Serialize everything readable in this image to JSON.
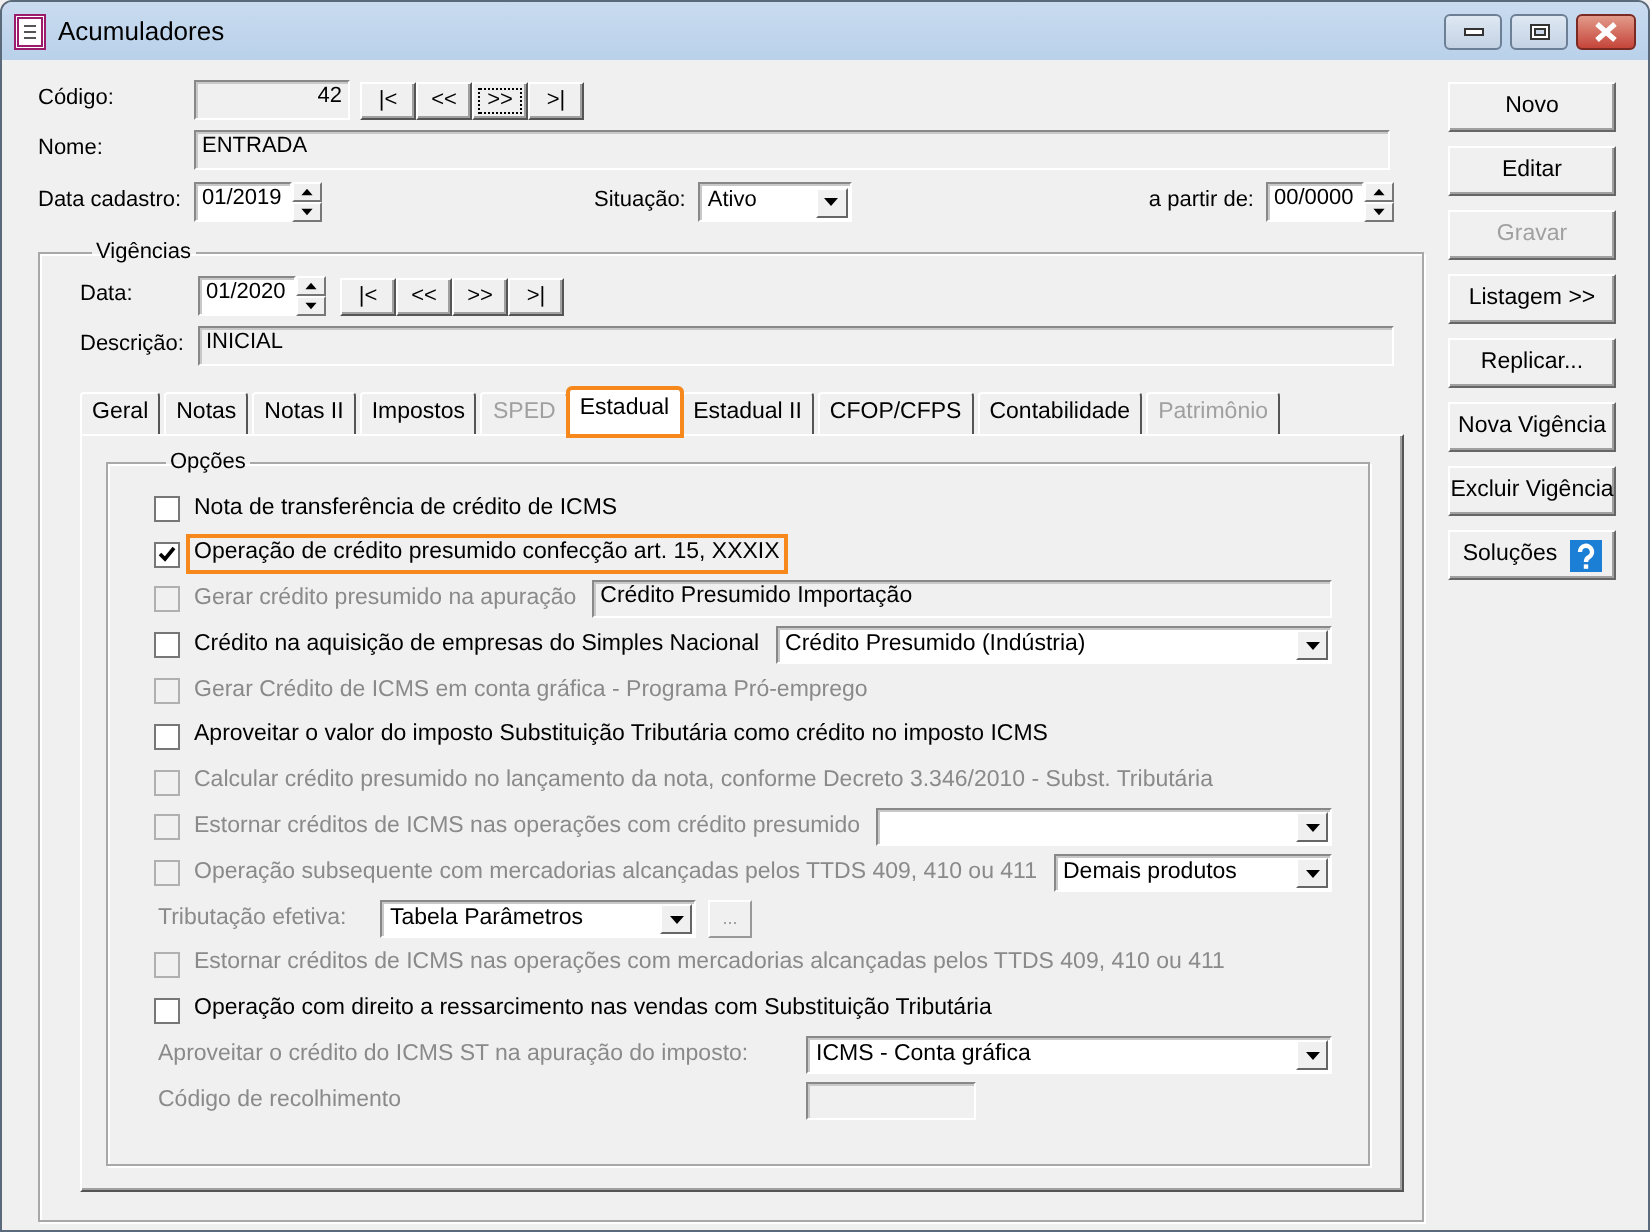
{
  "window": {
    "title": "Acumuladores"
  },
  "codigo": {
    "label": "Código:",
    "value": "42"
  },
  "record_nav": [
    {
      "label": "|<",
      "focused": false
    },
    {
      "label": "<<",
      "focused": false
    },
    {
      "label": ">>",
      "focused": true
    },
    {
      "label": ">|",
      "focused": false
    }
  ],
  "nome": {
    "label": "Nome:",
    "value": "ENTRADA"
  },
  "data_cadastro": {
    "label": "Data cadastro:",
    "value": "01/2019"
  },
  "situacao": {
    "label": "Situação:",
    "value": "Ativo"
  },
  "a_partir_de": {
    "label": "a partir de:",
    "value": "00/0000"
  },
  "vigencias": {
    "title": "Vigências",
    "data": {
      "label": "Data:",
      "value": "01/2020"
    },
    "nav": [
      {
        "label": "|<",
        "focused": false
      },
      {
        "label": "<<",
        "focused": false
      },
      {
        "label": ">>",
        "focused": false
      },
      {
        "label": ">|",
        "focused": false
      }
    ],
    "descricao": {
      "label": "Descrição:",
      "value": "INICIAL"
    }
  },
  "tabs": [
    {
      "label": "Geral",
      "selected": false,
      "disabled": false,
      "highlighted": false
    },
    {
      "label": "Notas",
      "selected": false,
      "disabled": false,
      "highlighted": false
    },
    {
      "label": "Notas II",
      "selected": false,
      "disabled": false,
      "highlighted": false
    },
    {
      "label": "Impostos",
      "selected": false,
      "disabled": false,
      "highlighted": false
    },
    {
      "label": "SPED",
      "selected": false,
      "disabled": true,
      "highlighted": false
    },
    {
      "label": "Estadual",
      "selected": true,
      "disabled": false,
      "highlighted": true
    },
    {
      "label": "Estadual II",
      "selected": false,
      "disabled": false,
      "highlighted": false
    },
    {
      "label": "CFOP/CFPS",
      "selected": false,
      "disabled": false,
      "highlighted": false
    },
    {
      "label": "Contabilidade",
      "selected": false,
      "disabled": false,
      "highlighted": false
    },
    {
      "label": "Patrimônio",
      "selected": false,
      "disabled": true,
      "highlighted": false
    }
  ],
  "options": {
    "title": "Opções",
    "items": [
      {
        "kind": "check",
        "label": "Nota de transferência de crédito de ICMS",
        "checked": false,
        "disabled": false,
        "highlighted": false
      },
      {
        "kind": "check",
        "label": "Operação de crédito presumido confecção art. 15, XXXIX",
        "checked": true,
        "disabled": false,
        "highlighted": true
      },
      {
        "kind": "check",
        "label": "Gerar crédito presumido na apuração",
        "checked": false,
        "disabled": true,
        "highlighted": false,
        "control": {
          "kind": "text",
          "value": "Crédito Presumido Importação"
        }
      },
      {
        "kind": "check",
        "label": "Crédito na aquisição de empresas do Simples Nacional",
        "checked": false,
        "disabled": false,
        "highlighted": false,
        "control": {
          "kind": "select",
          "value": "Crédito Presumido (Indústria)"
        }
      },
      {
        "kind": "check",
        "label": "Gerar Crédito de ICMS em conta gráfica - Programa Pró-emprego",
        "checked": false,
        "disabled": true,
        "highlighted": false
      },
      {
        "kind": "check",
        "label": "Aproveitar o valor do imposto Substituição Tributária como crédito no imposto ICMS",
        "checked": false,
        "disabled": false,
        "highlighted": false
      },
      {
        "kind": "check",
        "label": "Calcular crédito presumido no lançamento da nota, conforme Decreto 3.346/2010 - Subst. Tributária",
        "checked": false,
        "disabled": true,
        "highlighted": false
      },
      {
        "kind": "check",
        "label": "Estornar créditos de ICMS nas operações com crédito presumido",
        "checked": false,
        "disabled": true,
        "highlighted": false,
        "control": {
          "kind": "select"
        }
      },
      {
        "kind": "check",
        "label": "Operação subsequente com mercadorias alcançadas pelos TTDS 409, 410 ou 411",
        "checked": false,
        "disabled": true,
        "highlighted": false,
        "control": {
          "kind": "select",
          "value": "Demais produtos"
        }
      },
      {
        "kind": "label",
        "label": "Tributação efetiva:",
        "disabled": true,
        "control": {
          "kind": "select",
          "value": "Tabela Parâmetros",
          "button": "..."
        }
      },
      {
        "kind": "check",
        "label": "Estornar créditos de ICMS nas operações com mercadorias alcançadas pelos TTDS 409, 410 ou 411",
        "checked": false,
        "disabled": true,
        "highlighted": false
      },
      {
        "kind": "check",
        "label": "Operação com direito a ressarcimento nas vendas com Substituição Tributária",
        "checked": false,
        "disabled": false,
        "highlighted": false
      },
      {
        "kind": "label",
        "label": "Aproveitar o crédito do ICMS ST na apuração do imposto:",
        "disabled": true,
        "control": {
          "kind": "select",
          "value": "ICMS - Conta gráfica"
        }
      },
      {
        "kind": "label",
        "label": "Código de recolhimento",
        "disabled": true,
        "control": {
          "kind": "text"
        }
      }
    ]
  },
  "buttons": [
    {
      "label": "Novo",
      "disabled": false
    },
    {
      "label": "Editar",
      "disabled": false
    },
    {
      "label": "Gravar",
      "disabled": true
    },
    {
      "label": "Listagem >>",
      "disabled": false
    },
    {
      "label": "Replicar...",
      "disabled": false
    },
    {
      "label": "Nova Vigência",
      "disabled": false
    },
    {
      "label": "Excluir Vigência",
      "disabled": false
    },
    {
      "label": "Soluções",
      "disabled": false,
      "help_icon": true
    }
  ]
}
